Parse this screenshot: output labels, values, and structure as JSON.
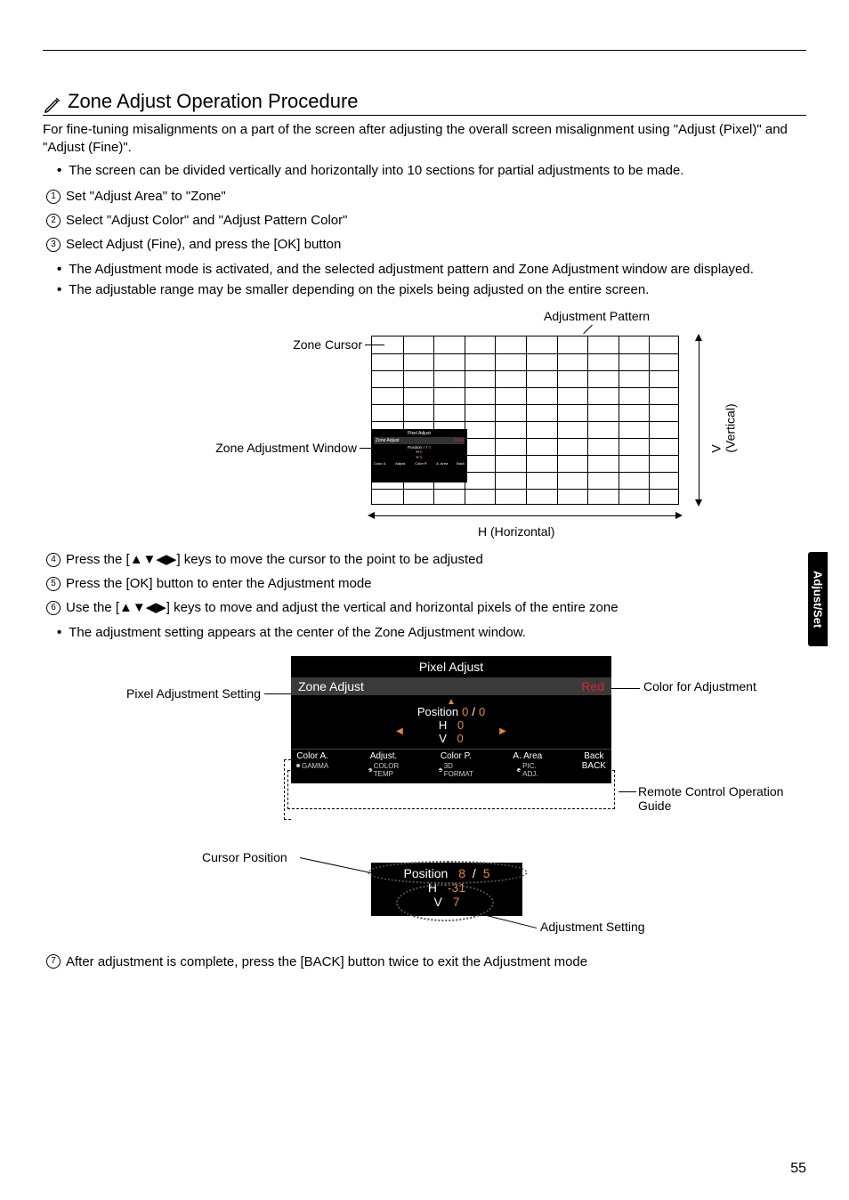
{
  "page_number": "55",
  "side_tab": "Adjust/Set",
  "heading": "Zone Adjust Operation Procedure",
  "intro": "For fine-tuning misalignments on a part of the screen after adjusting the overall screen misalignment using \"Adjust (Pixel)\" and \"Adjust (Fine)\".",
  "bullet1": "The screen can be divided vertically and horizontally into 10 sections for partial adjustments to be made.",
  "step1": "Set \"Adjust Area\" to \"Zone\"",
  "step2": "Select \"Adjust Color\" and \"Adjust Pattern Color\"",
  "step3": "Select Adjust (Fine), and press the [OK] button",
  "bullet2": "The Adjustment mode is activated, and the selected adjustment pattern and Zone Adjustment window are displayed.",
  "bullet3": "The adjustable range may be smaller depending on the pixels being adjusted on the entire screen.",
  "fig1": {
    "label_pattern": "Adjustment Pattern",
    "label_cursor": "Zone Cursor",
    "label_window": "Zone Adjustment Window",
    "h_axis": "H (Horizontal)",
    "v_axis": "V (Vertical)",
    "mini_osd": {
      "title": "Pixel Adjust",
      "zone_adjust": "Zone Adjust",
      "color": "Red",
      "position": "Position",
      "pos_x": "0",
      "pos_y": "0",
      "h_label": "H",
      "h_val": "0",
      "v_label": "V",
      "v_val": "0",
      "f1": "Color A.",
      "f2": "Adjust.",
      "f3": "Color P.",
      "f4": "A. Area",
      "f5": "Back",
      "s1": "GAMMA",
      "s2": "COLOR TEMP",
      "s3": "3D FORMAT",
      "s4": "PIC. ADJ.",
      "s5": "BACK"
    }
  },
  "step4_prefix": "Press the [",
  "step4_suffix": "] keys to move the cursor to the point to be adjusted",
  "step5": "Press the [OK] button to enter the Adjustment mode",
  "step6_prefix": "Use the [",
  "step6_suffix": "] keys to move and adjust the vertical and horizontal pixels of the entire zone",
  "bullet4": "The adjustment setting appears at the center of the Zone Adjustment window.",
  "fig2": {
    "label_left": "Pixel Adjustment Setting",
    "label_right1": "Color for Adjustment",
    "label_right2": "Remote Control Operation Guide",
    "osd": {
      "title": "Pixel Adjust",
      "zone_adjust": "Zone Adjust",
      "color": "Red",
      "position": "Position",
      "pos_x": "0",
      "pos_y": "0",
      "h_label": "H",
      "h_val": "0",
      "v_label": "V",
      "v_val": "0",
      "f1": "Color A.",
      "f2": "Adjust.",
      "f3": "Color P.",
      "f4": "A. Area",
      "f5": "Back",
      "s1": "GAMMA",
      "s2": "COLOR",
      "s2b": "TEMP",
      "s3": "3D",
      "s3b": "FORMAT",
      "s4": "PIC.",
      "s4b": "ADJ.",
      "s5": "BACK"
    }
  },
  "fig3": {
    "label_left": "Cursor Position",
    "label_right": "Adjustment Setting",
    "position": "Position",
    "pos_x": "8",
    "pos_y": "5",
    "h_label": "H",
    "h_val": "-31",
    "v_label": "V",
    "v_val": "7"
  },
  "step7": "After adjustment is complete, press the [BACK] button twice to exit the Adjustment mode"
}
